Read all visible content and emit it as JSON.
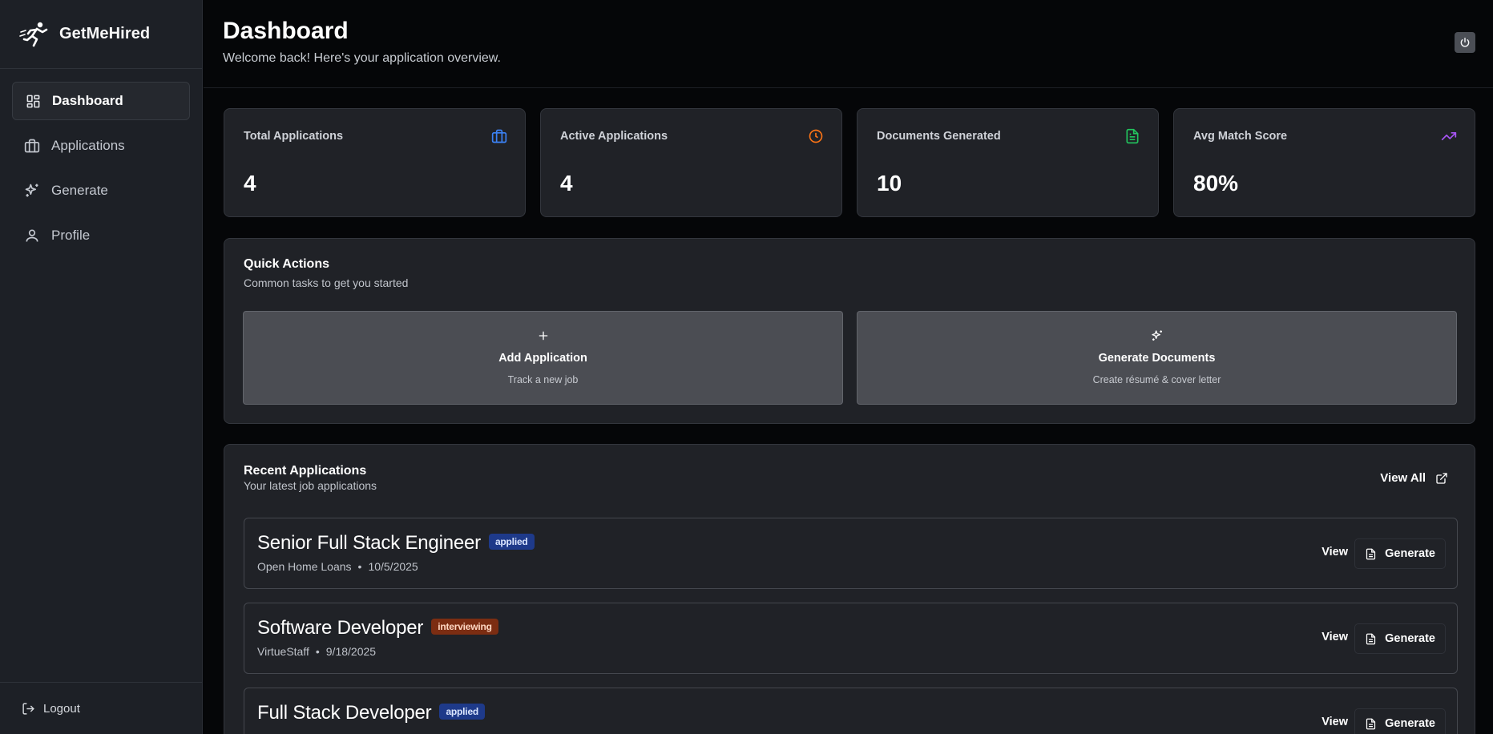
{
  "app": {
    "name": "GetMeHired"
  },
  "sidebar": {
    "items": [
      {
        "label": "Dashboard",
        "icon": "dashboard-grid-icon",
        "active": true
      },
      {
        "label": "Applications",
        "icon": "briefcase-icon",
        "active": false
      },
      {
        "label": "Generate",
        "icon": "sparkles-icon",
        "active": false
      },
      {
        "label": "Profile",
        "icon": "user-icon",
        "active": false
      }
    ],
    "logout_label": "Logout"
  },
  "header": {
    "title": "Dashboard",
    "subtitle": "Welcome back! Here's your application overview.",
    "power_icon": "power-icon"
  },
  "stats": [
    {
      "label": "Total Applications",
      "value": "4",
      "icon": "briefcase-icon",
      "color": "#3b82f6"
    },
    {
      "label": "Active Applications",
      "value": "4",
      "icon": "clock-icon",
      "color": "#f97316"
    },
    {
      "label": "Documents Generated",
      "value": "10",
      "icon": "file-text-icon",
      "color": "#22c55e"
    },
    {
      "label": "Avg Match Score",
      "value": "80%",
      "icon": "trending-up-icon",
      "color": "#a855f7"
    }
  ],
  "quick_actions": {
    "title": "Quick Actions",
    "subtitle": "Common tasks to get you started",
    "actions": [
      {
        "title": "Add Application",
        "subtitle": "Track a new job",
        "icon": "plus-icon"
      },
      {
        "title": "Generate Documents",
        "subtitle": "Create résumé & cover letter",
        "icon": "sparkles-icon"
      }
    ]
  },
  "recent": {
    "title": "Recent Applications",
    "subtitle": "Your latest job applications",
    "view_all_label": "View All",
    "view_label": "View",
    "generate_label": "Generate",
    "separator": "•",
    "items": [
      {
        "title": "Senior Full Stack Engineer",
        "status": "applied",
        "company": "Open Home Loans",
        "date": "10/5/2025"
      },
      {
        "title": "Software Developer",
        "status": "interviewing",
        "company": "VirtueStaff",
        "date": "9/18/2025"
      },
      {
        "title": "Full Stack Developer",
        "status": "applied",
        "company": "",
        "date": ""
      }
    ]
  }
}
